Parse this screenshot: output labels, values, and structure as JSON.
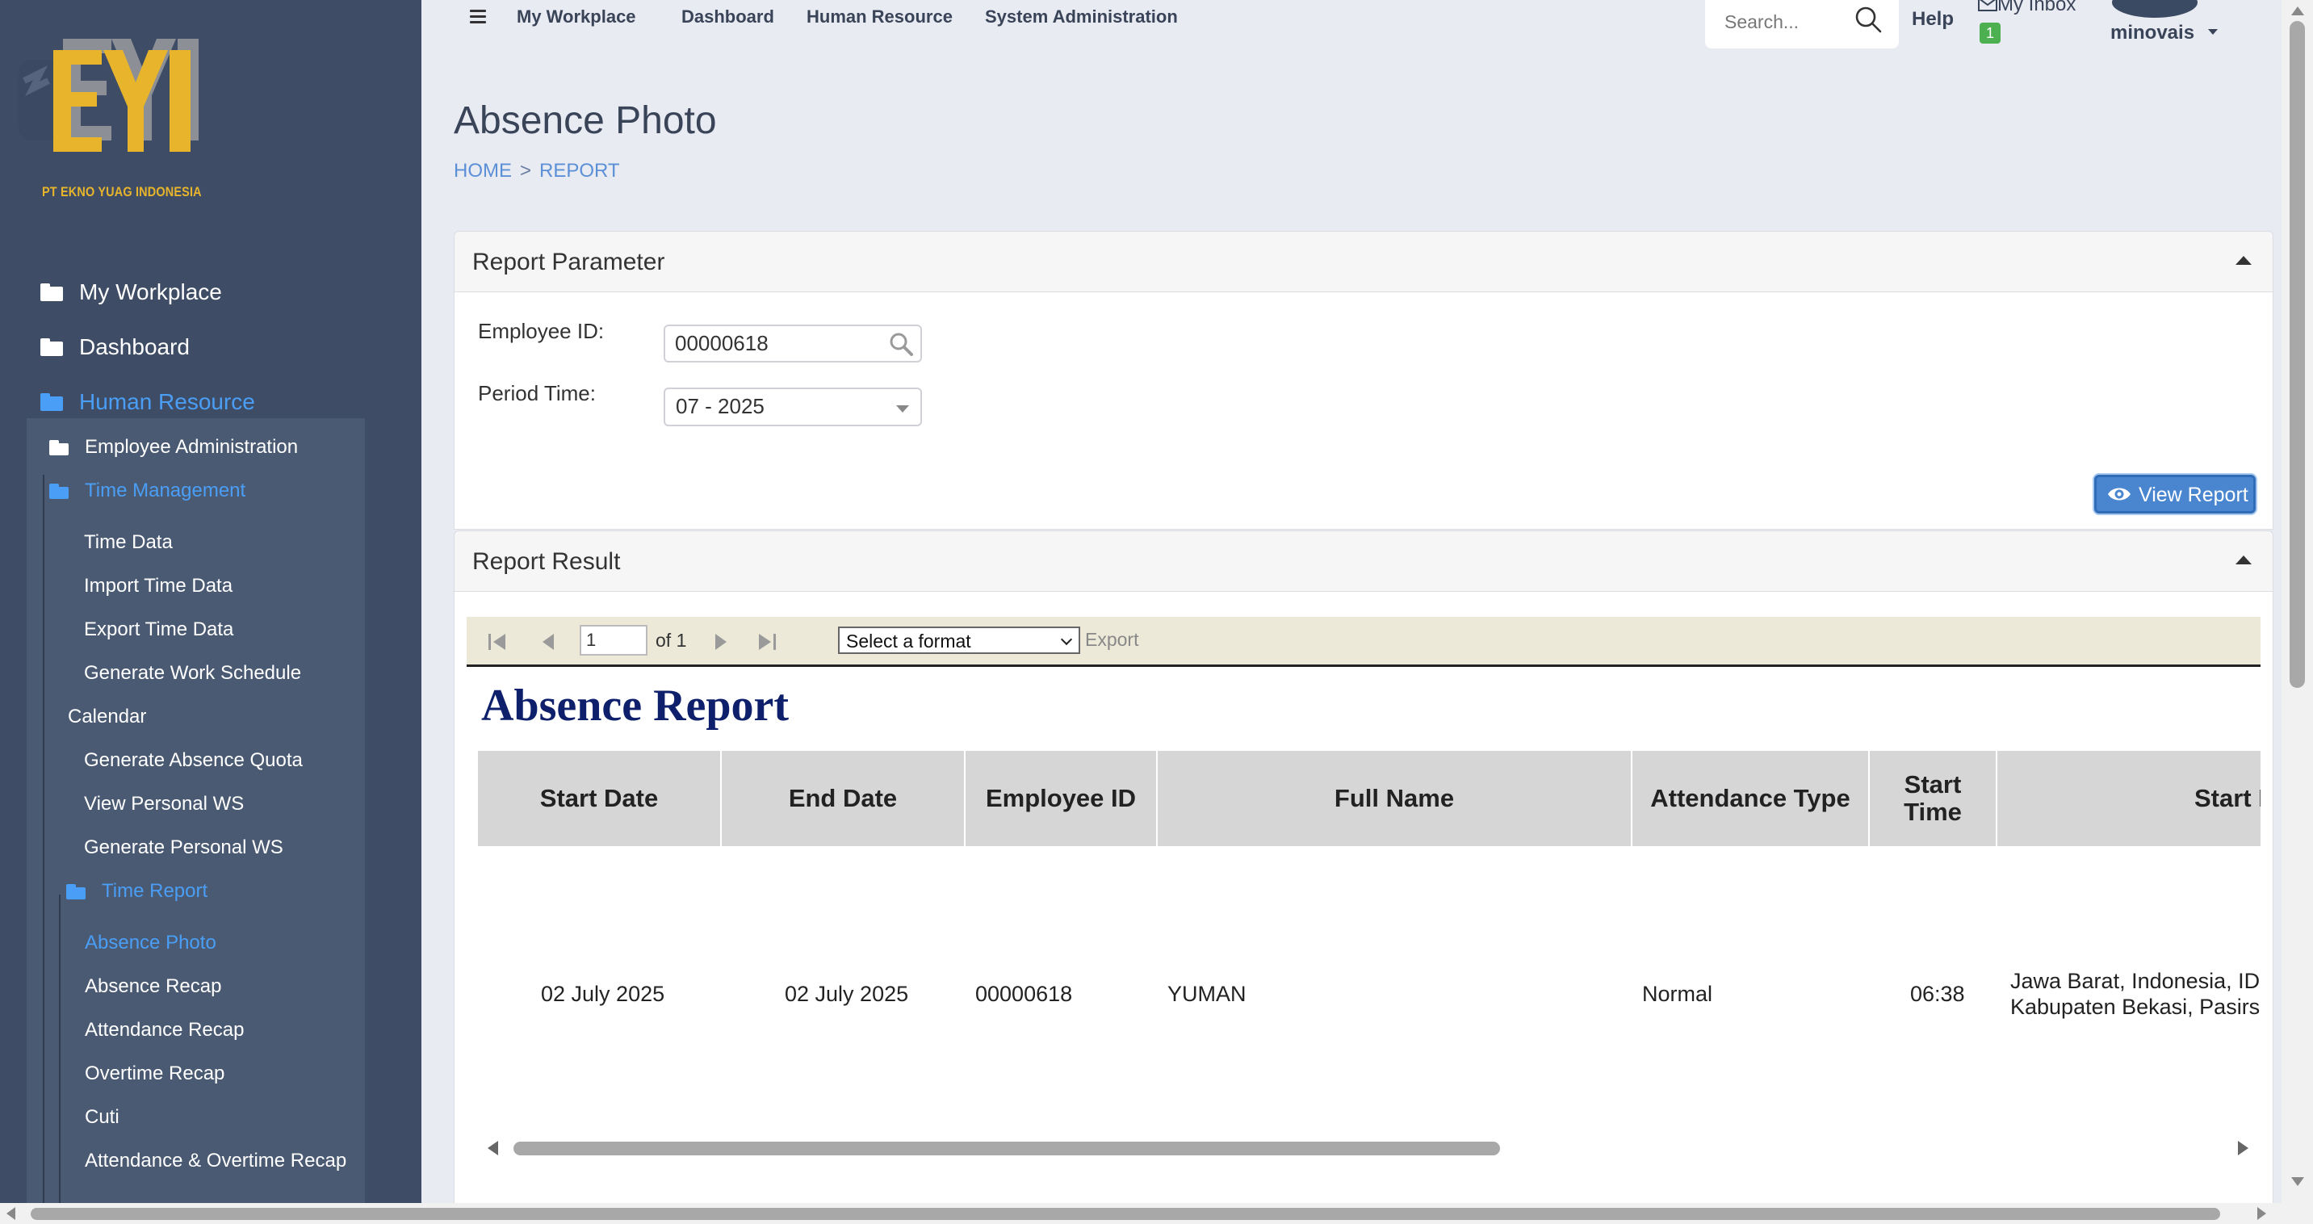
{
  "brand": {
    "company_name": "PT EKNO YUAG INDONESIA",
    "logo_letters": "EYI",
    "colors": {
      "logo_gold": "#e8b42b",
      "logo_shadow": "#8d8f97",
      "sidebar_bg": "#3e4d65",
      "accent": "#4a9ef5"
    }
  },
  "sidebar": {
    "top_items": [
      {
        "label": "My Workplace",
        "icon": "folder-icon",
        "active": false
      },
      {
        "label": "Dashboard",
        "icon": "folder-icon",
        "active": false
      },
      {
        "label": "Human Resource",
        "icon": "folder-open-icon",
        "active": true
      }
    ],
    "sub_items": {
      "employee_admin": "Employee Administration",
      "time_management": "Time Management",
      "time_data": "Time Data",
      "import_time_data": "Import Time Data",
      "export_time_data": "Export Time Data",
      "generate_work_schedule": "Generate Work Schedule",
      "calendar": "Calendar",
      "generate_absence_quota": "Generate Absence Quota",
      "view_personal_ws": "View Personal WS",
      "generate_personal_ws": "Generate Personal WS",
      "time_report": "Time Report",
      "absence_photo": "Absence Photo",
      "absence_recap": "Absence Recap",
      "attendance_recap": "Attendance Recap",
      "overtime_recap": "Overtime Recap",
      "cuti": "Cuti",
      "attendance_overtime_recap": "Attendance & Overtime Recap"
    }
  },
  "topbar": {
    "menu_icon": "hamburger-icon",
    "nav": [
      "My Workplace",
      "Dashboard",
      "Human Resource",
      "System Administration"
    ],
    "search_placeholder": "Search...",
    "help": "Help",
    "inbox_label": "My Inbox",
    "inbox_count": "1",
    "username": "minovais"
  },
  "page": {
    "title": "Absence Photo",
    "breadcrumb": [
      "HOME",
      "REPORT"
    ],
    "breadcrumb_sep": ">"
  },
  "report_parameter": {
    "header": "Report Parameter",
    "employee_id_label": "Employee ID:",
    "employee_id_value": "00000618",
    "period_label": "Period Time:",
    "period_value": "07 - 2025",
    "view_button": "View Report"
  },
  "report_result": {
    "header": "Report Result",
    "toolbar": {
      "page_value": "1",
      "page_of": "of 1",
      "format_placeholder": "Select a format",
      "export": "Export"
    },
    "title": "Absence Report",
    "columns": [
      "Start Date",
      "End Date",
      "Employee ID",
      "Full Name",
      "Attendance Type",
      "Start Time",
      "Start I"
    ],
    "rows": [
      {
        "start_date": "02 July 2025",
        "end_date": "02 July 2025",
        "employee_id": "00000618",
        "full_name": "YUMAN",
        "attendance_type": "Normal",
        "start_time": "06:38",
        "location_line1": "Jawa Barat, Indonesia, ID,",
        "location_line2": "Kabupaten Bekasi, Pasirs"
      }
    ]
  }
}
